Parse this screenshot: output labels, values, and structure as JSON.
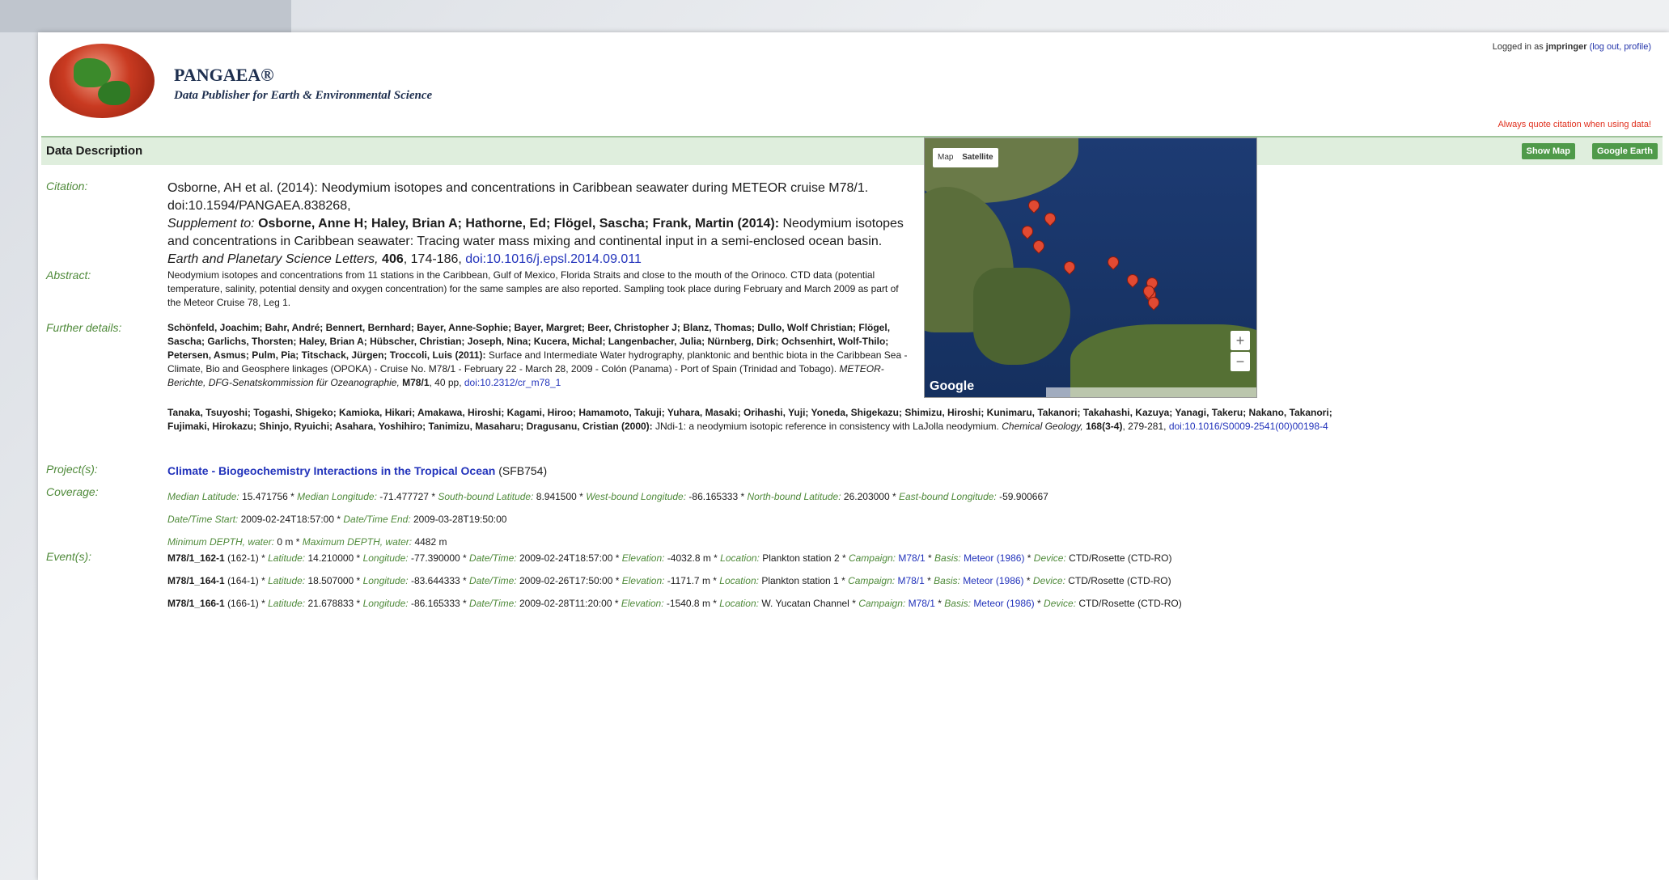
{
  "header": {
    "brand_name": "PANGAEA®",
    "brand_tagline": "Data Publisher for Earth & Environmental Science",
    "login_prefix": "Logged in as",
    "login_user": "jmpringer",
    "login_actions": "(log out, profile)",
    "quote_notice": "Always quote citation when using data!"
  },
  "section": {
    "title": "Data Description",
    "show_map_button": "Show Map",
    "google_earth_button": "Google Earth"
  },
  "citation": {
    "label": "Citation:",
    "line1": "Osborne, AH et al. (2014): Neodymium isotopes and concentrations in Caribbean seawater during METEOR cruise M78/1.",
    "line2": "doi:10.1594/PANGAEA.838268,",
    "supplement_prefix": "Supplement to:",
    "supplement_authors": "Osborne, Anne H; Haley, Brian A; Hathorne, Ed; Flögel, Sascha; Frank, Martin (2014):",
    "supplement_title": "Neodymium isotopes and concentrations in Caribbean seawater: Tracing water mass mixing and continental input in a semi-enclosed ocean basin.",
    "journal": "Earth and Planetary Science Letters,",
    "volume": "406",
    "pages": ", 174-186,",
    "doi_link": "doi:10.1016/j.epsl.2014.09.011"
  },
  "abstract": {
    "label": "Abstract:",
    "text": "Neodymium isotopes and concentrations from 11 stations in the Caribbean, Gulf of Mexico, Florida Straits and close to the mouth of the Orinoco. CTD data (potential temperature, salinity, potential density and oxygen concentration) for the same samples are also reported. Sampling took place during February and March 2009 as part of the Meteor Cruise 78, Leg 1."
  },
  "further": {
    "label": "Further details:",
    "ref1_authors": "Schönfeld, Joachim; Bahr, André; Bennert, Bernhard; Bayer, Anne-Sophie; Bayer, Margret; Beer, Christopher J; Blanz, Thomas; Dullo, Wolf Christian; Flögel, Sascha; Garlichs, Thorsten; Haley, Brian A; Hübscher, Christian; Joseph, Nina; Kucera, Michal; Langenbacher, Julia; Nürnberg, Dirk; Ochsenhirt, Wolf-Thilo; Petersen, Asmus; Pulm, Pia; Titschack, Jürgen; Troccoli, Luis (2011):",
    "ref1_title": "Surface and Intermediate Water hydrography, planktonic and benthic biota in the Caribbean Sea - Climate, Bio and Geosphere linkages (OPOKA) - Cruise No. M78/1 - February 22 - March 28, 2009 - Colón (Panama) - Port of Spain (Trinidad and Tobago).",
    "ref1_series": "METEOR-Berichte, DFG-Senatskommission für Ozeanographie,",
    "ref1_vol": "M78/1",
    "ref1_pages": ", 40 pp,",
    "ref1_doi": "doi:10.2312/cr_m78_1",
    "ref2_authors": "Tanaka, Tsuyoshi; Togashi, Shigeko; Kamioka, Hikari; Amakawa, Hiroshi; Kagami, Hiroo; Hamamoto, Takuji; Yuhara, Masaki; Orihashi, Yuji; Yoneda, Shigekazu; Shimizu, Hiroshi; Kunimaru, Takanori; Takahashi, Kazuya; Yanagi, Takeru; Nakano, Takanori; Fujimaki, Hirokazu; Shinjo, Ryuichi; Asahara, Yoshihiro; Tanimizu, Masaharu; Dragusanu, Cristian (2000):",
    "ref2_title": "JNdi-1: a neodymium isotopic reference in consistency with LaJolla neodymium.",
    "ref2_journal": "Chemical Geology,",
    "ref2_vol": "168(3-4)",
    "ref2_pages": ", 279-281,",
    "ref2_doi": "doi:10.1016/S0009-2541(00)00198-4"
  },
  "project": {
    "label": "Project(s):",
    "name": "Climate - Biogeochemistry Interactions in the Tropical Ocean",
    "code": "(SFB754)"
  },
  "coverage": {
    "label": "Coverage:",
    "median_lat_label": "Median Latitude:",
    "median_lat": "15.471756",
    "median_lon_label": "Median Longitude:",
    "median_lon": "-71.477727",
    "south_label": "South-bound Latitude:",
    "south": "8.941500",
    "west_label": "West-bound Longitude:",
    "west": "-86.165333",
    "north_label": "North-bound Latitude:",
    "north": "26.203000",
    "east_label": "East-bound Longitude:",
    "east": "-59.900667",
    "start_label": "Date/Time Start:",
    "start": "2009-02-24T18:57:00",
    "end_label": "Date/Time End:",
    "end": "2009-03-28T19:50:00",
    "min_depth_label": "Minimum DEPTH, water:",
    "min_depth": "0 m",
    "max_depth_label": "Maximum DEPTH, water:",
    "max_depth": "4482 m"
  },
  "events": {
    "label": "Event(s):",
    "items": [
      {
        "id": "M78/1_162-1",
        "alias": "(162-1)",
        "lat": "14.210000",
        "lon": "-77.390000",
        "datetime": "2009-02-24T18:57:00",
        "elevation": "-4032.8 m",
        "location": "Plankton station 2",
        "campaign": "M78/1",
        "basis": "Meteor (1986)",
        "device": "CTD/Rosette (CTD-RO)"
      },
      {
        "id": "M78/1_164-1",
        "alias": "(164-1)",
        "lat": "18.507000",
        "lon": "-83.644333",
        "datetime": "2009-02-26T17:50:00",
        "elevation": "-1171.7 m",
        "location": "Plankton station 1",
        "campaign": "M78/1",
        "basis": "Meteor (1986)",
        "device": "CTD/Rosette (CTD-RO)"
      },
      {
        "id": "M78/1_166-1",
        "alias": "(166-1)",
        "lat": "21.678833",
        "lon": "-86.165333",
        "datetime": "2009-02-28T11:20:00",
        "elevation": "-1540.8 m",
        "location": "W. Yucatan Channel",
        "campaign": "M78/1",
        "basis": "Meteor (1986)",
        "device": "CTD/Rosette (CTD-RO)"
      }
    ],
    "field_labels": {
      "latitude": "Latitude:",
      "longitude": "Longitude:",
      "datetime": "Date/Time:",
      "elevation": "Elevation:",
      "location": "Location:",
      "campaign": "Campaign:",
      "basis": "Basis:",
      "device": "Device:"
    }
  },
  "map": {
    "type_map": "Map",
    "type_satellite": "Satellite",
    "zoom_in": "+",
    "zoom_out": "−",
    "provider": "Google",
    "marker_count": 11
  }
}
